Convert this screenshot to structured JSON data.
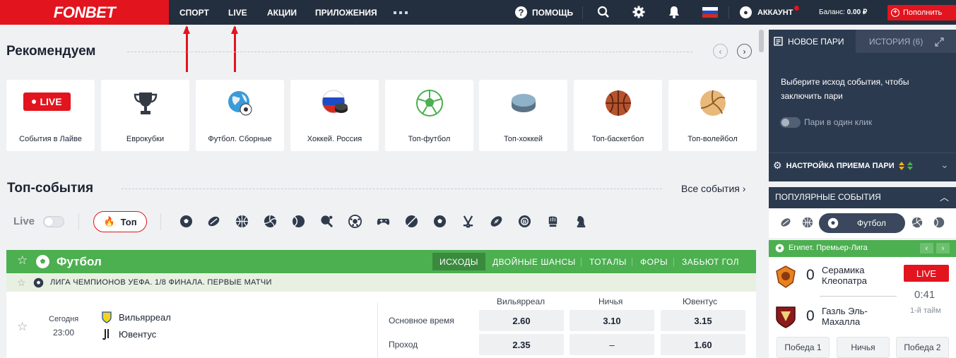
{
  "header": {
    "logo": "FONBET",
    "nav": [
      "СПОРТ",
      "LIVE",
      "АКЦИИ",
      "ПРИЛОЖЕНИЯ"
    ],
    "help": "ПОМОЩЬ",
    "account": "АККАУНТ",
    "balance_label": "Баланс:",
    "balance_value": "0.00 ₽",
    "deposit": "Пополнить"
  },
  "recommend": {
    "title": "Рекомендуем",
    "live_badge": "LIVE",
    "cards": [
      "События в Лайве",
      "Еврокубки",
      "Футбол. Сборные",
      "Хоккей. Россия",
      "Топ-футбол",
      "Топ-хоккей",
      "Топ-баскетбол",
      "Топ-волейбол"
    ]
  },
  "top_events": {
    "title": "Топ-события",
    "all_link": "Все события",
    "live_label": "Live",
    "top_button": "Топ",
    "sport_icons": [
      "football-icon",
      "rugby-icon",
      "basketball-icon",
      "volleyball-icon",
      "tennis-icon",
      "table-tennis-icon",
      "futsal-icon",
      "esports-icon",
      "cricket-icon",
      "football-icon",
      "hockey-icon",
      "american-football-icon",
      "bandy-icon",
      "boxing-icon",
      "chess-icon"
    ]
  },
  "sport_section": {
    "name": "Футбол",
    "tabs": [
      "ИСХОДЫ",
      "ДВОЙНЫЕ ШАНСЫ",
      "ТОТАЛЫ",
      "ФОРЫ",
      "ЗАБЬЮТ ГОЛ"
    ],
    "league": "ЛИГА ЧЕМПИОНОВ УЕФА. 1/8 ФИНАЛА. ПЕРВЫЕ МАТЧИ",
    "match": {
      "day": "Сегодня",
      "time": "23:00",
      "team1": "Вильярреал",
      "team2": "Ювентус",
      "columns": [
        "Вильярреал",
        "Ничья",
        "Ювентус"
      ],
      "rows": [
        {
          "label": "Основное время",
          "odds": [
            "2.60",
            "3.10",
            "3.15"
          ]
        },
        {
          "label": "Проход",
          "odds": [
            "2.35",
            "–",
            "1.60"
          ]
        }
      ]
    }
  },
  "betslip": {
    "tab_new": "НОВОЕ ПАРИ",
    "tab_history": "ИСТОРИЯ (6)",
    "hint": "Выберите исход события, чтобы заключить пари",
    "one_click": "Пари в один клик",
    "settings": "НАСТРОЙКА ПРИЕМА ПАРИ"
  },
  "popular": {
    "title": "ПОПУЛЯРНЫЕ СОБЫТИЯ",
    "selected_sport": "Футбол",
    "league": "Египет. Премьер-Лига",
    "team1": "Серамика Клеопатра",
    "team2": "Газль Эль-Махалла",
    "score1": "0",
    "score2": "0",
    "live": "LIVE",
    "time": "0:41",
    "half": "1-й тайм",
    "outcomes": [
      "Победа 1",
      "Ничья",
      "Победа 2"
    ]
  },
  "colors": {
    "brand_red": "#e2141e",
    "header_bg": "#232f3e",
    "green": "#4caf50",
    "panel_bg": "#2c3a4f"
  }
}
